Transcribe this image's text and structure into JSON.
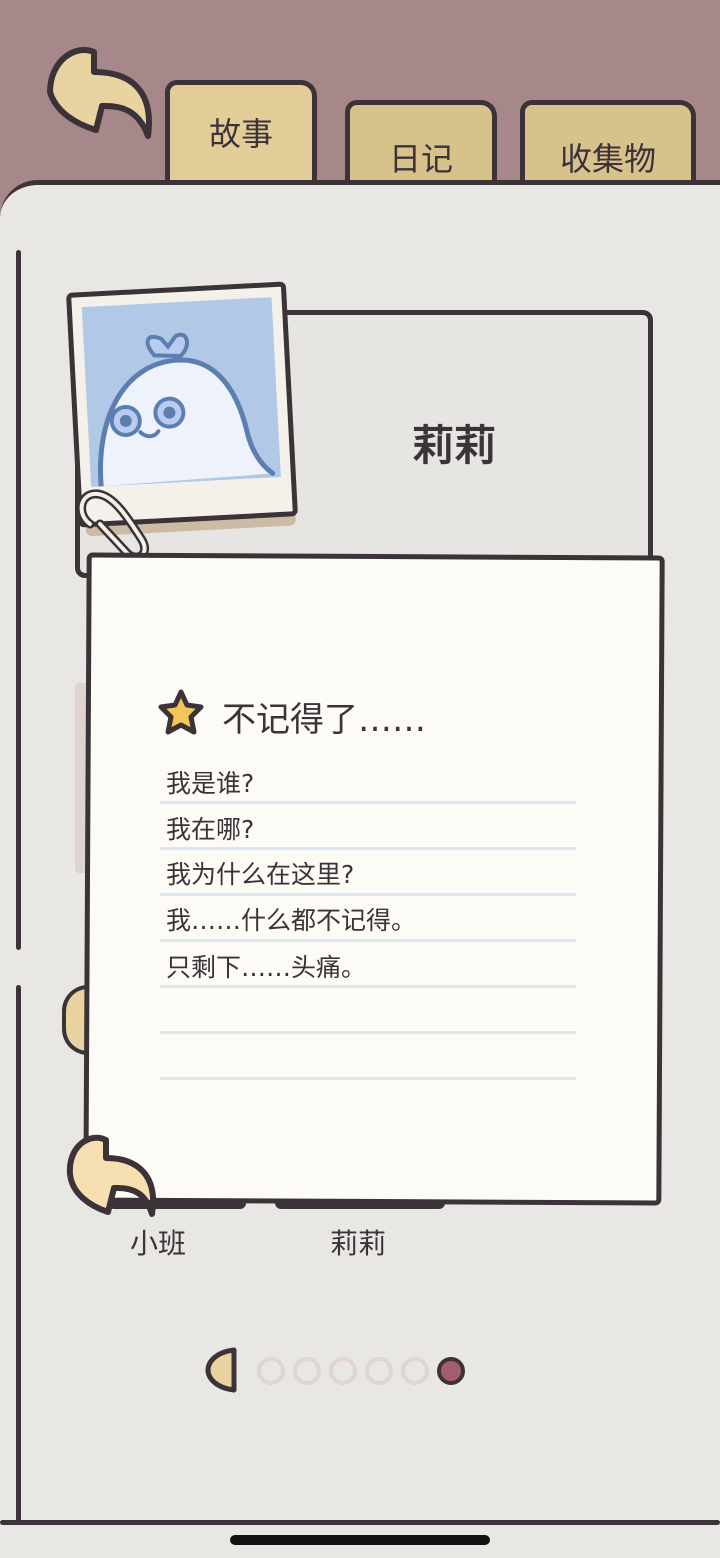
{
  "tabs": [
    {
      "label": "故事",
      "active": true
    },
    {
      "label": "日记",
      "active": false
    },
    {
      "label": "收集物",
      "active": false
    }
  ],
  "character": {
    "name": "莉莉"
  },
  "note": {
    "heading": "不记得了……",
    "lines": [
      "我是谁?",
      "我在哪?",
      "我为什么在这里?",
      "我……什么都不记得。",
      "只剩下……头痛。"
    ]
  },
  "list_names": [
    "小班",
    "莉莉"
  ],
  "pagination": {
    "total": 6,
    "current": 6
  },
  "colors": {
    "background": "#a6878a",
    "page": "#e9e7e3",
    "outline": "#3b3338",
    "tab": "#e2cd98",
    "accent_dot": "#a35d6c",
    "photo_blue": "#b1c9e6",
    "star": "#f1c75a"
  },
  "icons": [
    "back-arrow-icon",
    "star-icon",
    "paperclip-icon",
    "prev-page-icon",
    "close-note-icon"
  ]
}
